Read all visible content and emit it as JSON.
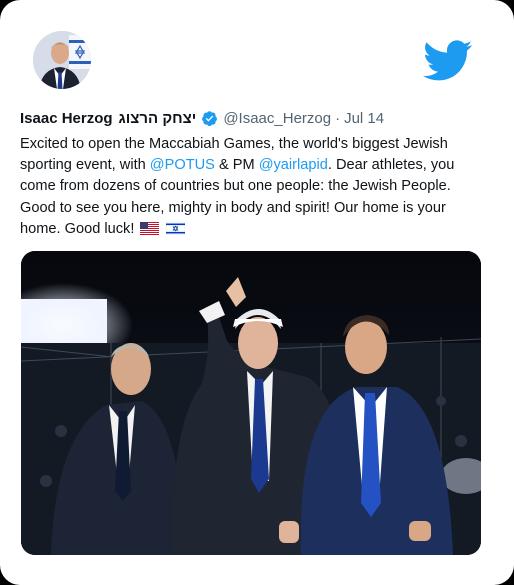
{
  "author": {
    "name": "Isaac Herzog",
    "name_hebrew": "יצחק הרצוג",
    "handle": "@Isaac_Herzog",
    "separator": "·",
    "date": "Jul 14",
    "verified": true
  },
  "tweet": {
    "text_1": "Excited to open the Maccabiah Games, the world's biggest Jewish sporting event, with ",
    "mention_1": "@POTUS",
    "text_2": " & PM ",
    "mention_2": "@yairlapid",
    "text_3": ". Dear athletes, you come from dozens of countries but one people: the Jewish People. Good to see you here, mighty in body and spirit! Our home is your home. Good luck!",
    "flags": [
      "us-flag",
      "israel-flag"
    ]
  },
  "colors": {
    "twitter_blue": "#1d9bf0",
    "text": "#0f1419",
    "muted": "#536471"
  },
  "icons": [
    "twitter-bird-icon",
    "verified-badge-icon"
  ],
  "media": {
    "type": "photo"
  }
}
